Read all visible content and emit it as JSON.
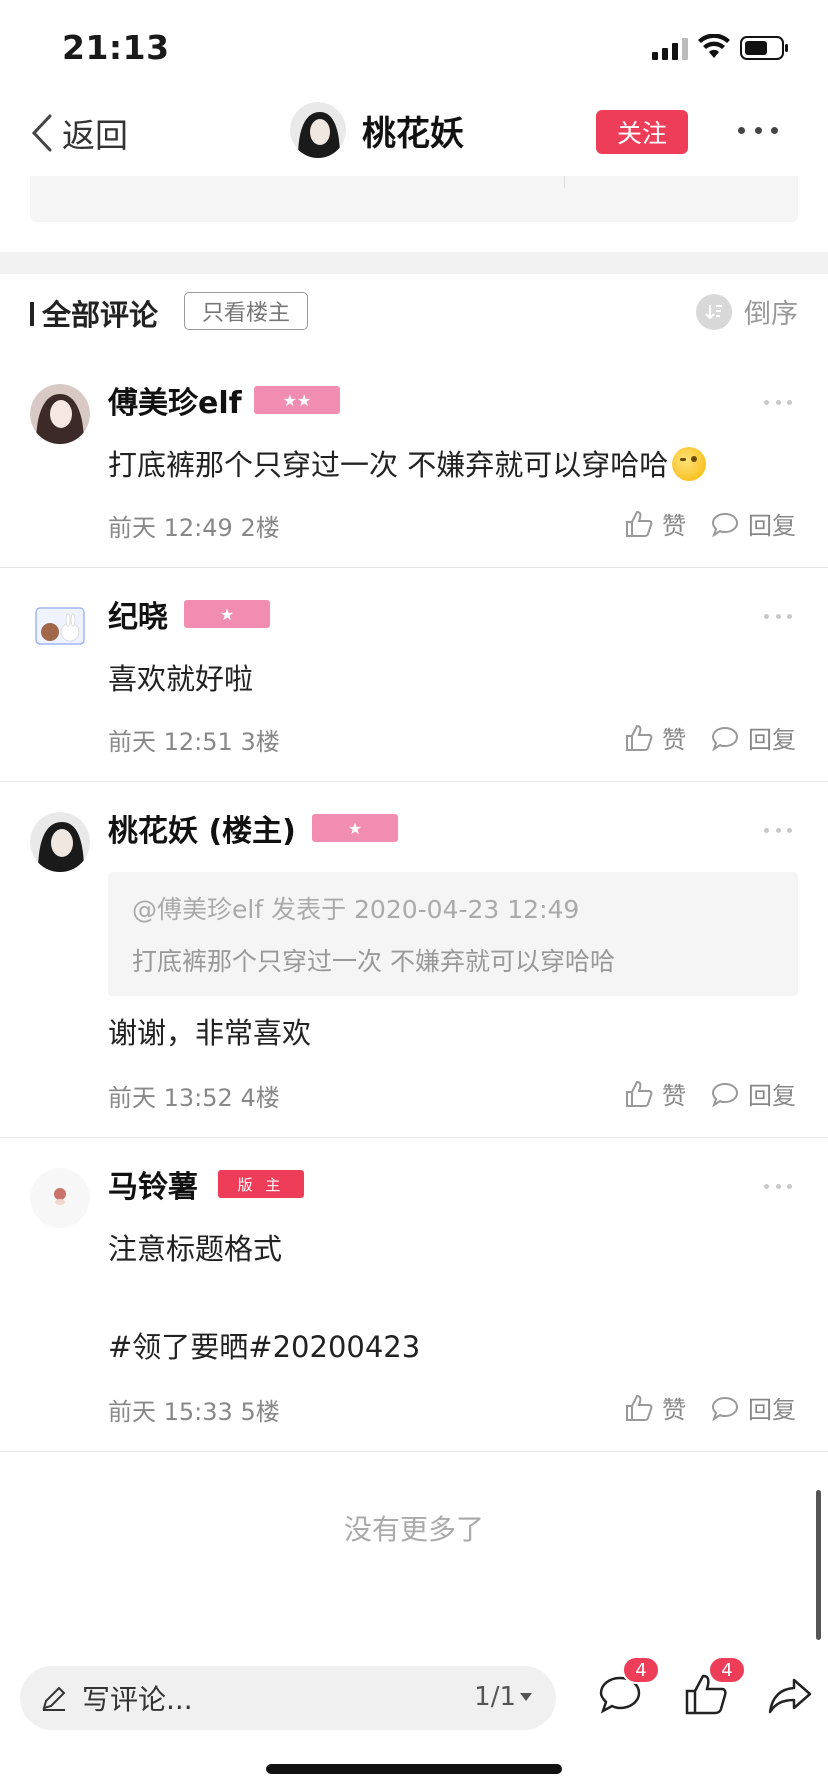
{
  "status_bar": {
    "time": "21:13"
  },
  "nav": {
    "back_label": "返回",
    "title": "桃花妖",
    "follow_label": "关注"
  },
  "comments_header": {
    "title": "全部评论",
    "only_op_label": "只看楼主",
    "sort_label": "倒序"
  },
  "comments": [
    {
      "name": "傅美珍elf",
      "badge": "★★",
      "text": "打底裤那个只穿过一次 不嫌弃就可以穿哈哈",
      "time": "前天 12:49",
      "floor": "2楼",
      "like_label": "赞",
      "reply_label": "回复"
    },
    {
      "name": "纪晓",
      "badge": "★",
      "text": "喜欢就好啦",
      "time": "前天 12:51",
      "floor": "3楼",
      "like_label": "赞",
      "reply_label": "回复"
    },
    {
      "name": "桃花妖 (楼主)",
      "badge": "★",
      "quote_head": "@傅美珍elf 发表于 2020-04-23 12:49",
      "quote_text": "打底裤那个只穿过一次 不嫌弃就可以穿哈哈",
      "text": "谢谢，非常喜欢",
      "time": "前天 13:52",
      "floor": "4楼",
      "like_label": "赞",
      "reply_label": "回复"
    },
    {
      "name": "马铃薯",
      "badge": "版 主",
      "text": "注意标题格式",
      "text2": "#领了要晒#20200423",
      "time": "前天 15:33",
      "floor": "5楼",
      "like_label": "赞",
      "reply_label": "回复"
    }
  ],
  "footer": {
    "no_more": "没有更多了"
  },
  "bottom_bar": {
    "placeholder": "写评论...",
    "page": "1/1",
    "comment_count": "4",
    "like_count": "4"
  },
  "colors": {
    "accent": "#ee3d59",
    "badge_pink": "#f08db0"
  }
}
